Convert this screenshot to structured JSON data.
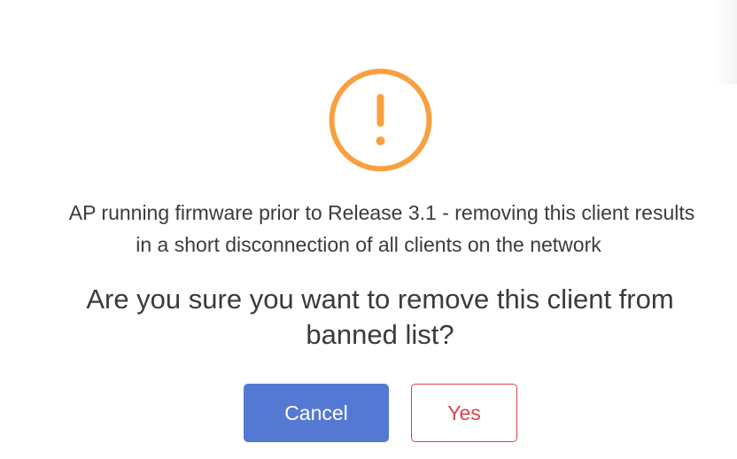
{
  "dialog": {
    "icon": "exclamation-circle-icon",
    "icon_color": "#f8a040",
    "warning_line1": "AP running firmware prior to Release 3.1 - removing this client results",
    "warning_line2": "in a short disconnection of all clients on the network",
    "question_line1": "Are you sure you want to remove this client from",
    "question_line2": "banned list?",
    "cancel_label": "Cancel",
    "yes_label": "Yes",
    "colors": {
      "primary": "#5479d3",
      "danger": "#d9424b",
      "text": "#3b3b3b"
    }
  }
}
